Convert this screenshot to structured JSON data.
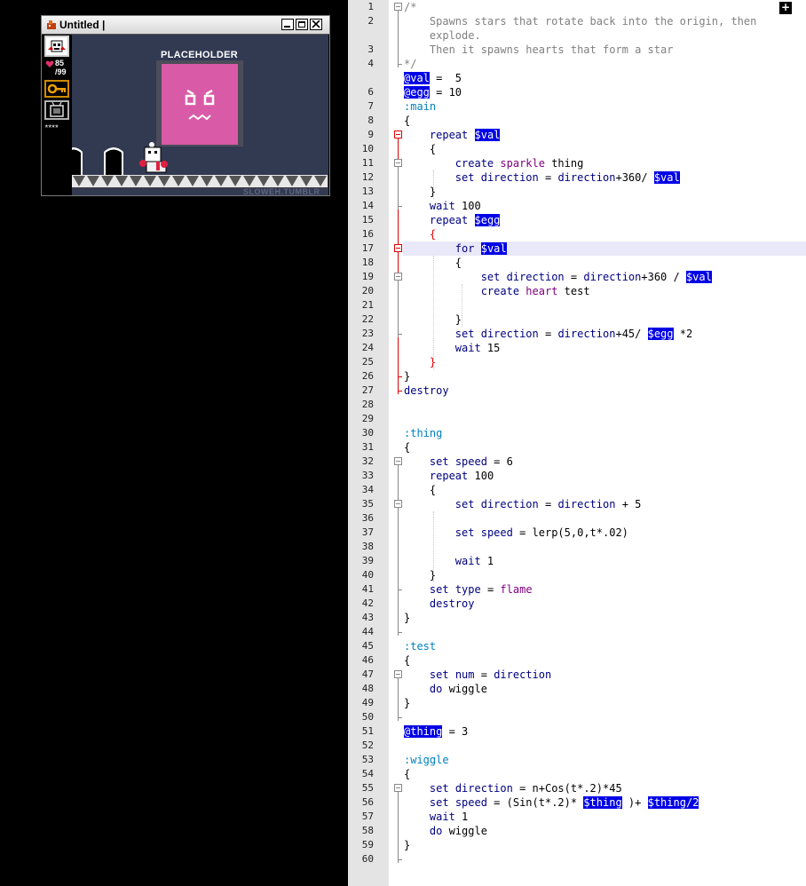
{
  "window": {
    "title": "Untitled |"
  },
  "hud": {
    "health": "85",
    "health_max": "/99",
    "stars": "★★★★"
  },
  "stage": {
    "placeholder_label": "PLACEHOLDER",
    "watermark": "SLOWEH.TUMBLR"
  },
  "editor": {
    "plus_button": "+",
    "lines": [
      [
        [
          "c",
          "/*"
        ]
      ],
      [
        [
          "c",
          "    Spawns stars that rotate back into the origin, then"
        ]
      ],
      [
        [
          "c",
          "    explode."
        ]
      ],
      [
        [
          "c",
          "    Then it spawns hearts that form a star"
        ]
      ],
      [
        [
          "c",
          "*/"
        ]
      ],
      [
        [
          "v",
          "@val"
        ],
        [
          "n",
          " =  5"
        ]
      ],
      [
        [
          "v",
          "@egg"
        ],
        [
          "n",
          " = 10"
        ]
      ],
      [
        [
          "lbl",
          ":main"
        ]
      ],
      [
        [
          "n",
          "{"
        ]
      ],
      [
        [
          "n",
          "    "
        ],
        [
          "k",
          "repeat"
        ],
        [
          "n",
          " "
        ],
        [
          "v",
          "$val"
        ]
      ],
      [
        [
          "n",
          "    {"
        ]
      ],
      [
        [
          "n",
          "        "
        ],
        [
          "k",
          "create"
        ],
        [
          "n",
          " "
        ],
        [
          "p",
          "sparkle"
        ],
        [
          "n",
          " thing"
        ]
      ],
      [
        [
          "n",
          "        "
        ],
        [
          "k",
          "set"
        ],
        [
          "n",
          " "
        ],
        [
          "k",
          "direction"
        ],
        [
          "n",
          " = "
        ],
        [
          "k",
          "direction"
        ],
        [
          "n",
          "+360/ "
        ],
        [
          "v",
          "$val"
        ]
      ],
      [
        [
          "n",
          "    }"
        ]
      ],
      [
        [
          "n",
          "    "
        ],
        [
          "k",
          "wait"
        ],
        [
          "n",
          " 100"
        ]
      ],
      [
        [
          "n",
          "    "
        ],
        [
          "k",
          "repeat"
        ],
        [
          "n",
          " "
        ],
        [
          "v",
          "$egg"
        ]
      ],
      [
        [
          "n",
          "    "
        ],
        [
          "redbrace",
          "{"
        ]
      ],
      [
        [
          "n",
          "        "
        ],
        [
          "k",
          "for"
        ],
        [
          "n",
          " "
        ],
        [
          "v",
          "$val"
        ]
      ],
      [
        [
          "n",
          "        {"
        ]
      ],
      [
        [
          "n",
          "            "
        ],
        [
          "k",
          "set"
        ],
        [
          "n",
          " "
        ],
        [
          "k",
          "direction"
        ],
        [
          "n",
          " = "
        ],
        [
          "k",
          "direction"
        ],
        [
          "n",
          "+360 / "
        ],
        [
          "v",
          "$val"
        ]
      ],
      [
        [
          "n",
          "            "
        ],
        [
          "k",
          "create"
        ],
        [
          "n",
          " "
        ],
        [
          "p",
          "heart"
        ],
        [
          "n",
          " test"
        ]
      ],
      [
        [
          "n",
          ""
        ]
      ],
      [
        [
          "n",
          "        }"
        ]
      ],
      [
        [
          "n",
          "        "
        ],
        [
          "k",
          "set"
        ],
        [
          "n",
          " "
        ],
        [
          "k",
          "direction"
        ],
        [
          "n",
          " = "
        ],
        [
          "k",
          "direction"
        ],
        [
          "n",
          "+45/ "
        ],
        [
          "v",
          "$egg"
        ],
        [
          "n",
          " *2"
        ]
      ],
      [
        [
          "n",
          "        "
        ],
        [
          "k",
          "wait"
        ],
        [
          "n",
          " 15"
        ]
      ],
      [
        [
          "n",
          "    "
        ],
        [
          "redbrace",
          "}"
        ]
      ],
      [
        [
          "n",
          "}"
        ]
      ],
      [
        [
          "k",
          "destroy"
        ]
      ],
      [
        [
          "n",
          ""
        ]
      ],
      [
        [
          "n",
          ""
        ]
      ],
      [
        [
          "lbl",
          ":thing"
        ]
      ],
      [
        [
          "n",
          "{"
        ]
      ],
      [
        [
          "n",
          "    "
        ],
        [
          "k",
          "set"
        ],
        [
          "n",
          " "
        ],
        [
          "k",
          "speed"
        ],
        [
          "n",
          " = 6"
        ]
      ],
      [
        [
          "n",
          "    "
        ],
        [
          "k",
          "repeat"
        ],
        [
          "n",
          " 100"
        ]
      ],
      [
        [
          "n",
          "    {"
        ]
      ],
      [
        [
          "n",
          "        "
        ],
        [
          "k",
          "set"
        ],
        [
          "n",
          " "
        ],
        [
          "k",
          "direction"
        ],
        [
          "n",
          " = "
        ],
        [
          "k",
          "direction"
        ],
        [
          "n",
          " + 5"
        ]
      ],
      [
        [
          "n",
          ""
        ]
      ],
      [
        [
          "n",
          "        "
        ],
        [
          "k",
          "set"
        ],
        [
          "n",
          " "
        ],
        [
          "k",
          "speed"
        ],
        [
          "n",
          " = lerp(5,0,t*.02)"
        ]
      ],
      [
        [
          "n",
          ""
        ]
      ],
      [
        [
          "n",
          "        "
        ],
        [
          "k",
          "wait"
        ],
        [
          "n",
          " 1"
        ]
      ],
      [
        [
          "n",
          "    }"
        ]
      ],
      [
        [
          "n",
          "    "
        ],
        [
          "k",
          "set"
        ],
        [
          "n",
          " "
        ],
        [
          "k",
          "type"
        ],
        [
          "n",
          " = "
        ],
        [
          "p",
          "flame"
        ]
      ],
      [
        [
          "n",
          "    "
        ],
        [
          "k",
          "destroy"
        ]
      ],
      [
        [
          "n",
          "}"
        ]
      ],
      [
        [
          "n",
          ""
        ]
      ],
      [
        [
          "lbl",
          ":test"
        ]
      ],
      [
        [
          "n",
          "{"
        ]
      ],
      [
        [
          "n",
          "    "
        ],
        [
          "k",
          "set"
        ],
        [
          "n",
          " "
        ],
        [
          "k",
          "num"
        ],
        [
          "n",
          " = "
        ],
        [
          "k",
          "direction"
        ]
      ],
      [
        [
          "n",
          "    "
        ],
        [
          "k",
          "do"
        ],
        [
          "n",
          " wiggle"
        ]
      ],
      [
        [
          "n",
          "}"
        ]
      ],
      [
        [
          "n",
          ""
        ]
      ],
      [
        [
          "v",
          "@thing"
        ],
        [
          "n",
          " = 3"
        ]
      ],
      [
        [
          "n",
          ""
        ]
      ],
      [
        [
          "lbl",
          ":wiggle"
        ]
      ],
      [
        [
          "n",
          "{"
        ]
      ],
      [
        [
          "n",
          "    "
        ],
        [
          "k",
          "set"
        ],
        [
          "n",
          " "
        ],
        [
          "k",
          "direction"
        ],
        [
          "n",
          " = n+Cos(t*.2)*45"
        ]
      ],
      [
        [
          "n",
          "    "
        ],
        [
          "k",
          "set"
        ],
        [
          "n",
          " "
        ],
        [
          "k",
          "speed"
        ],
        [
          "n",
          " = (Sin(t*.2)* "
        ],
        [
          "v",
          "$thing"
        ],
        [
          "n",
          " )+ "
        ],
        [
          "v",
          "$thing/2"
        ]
      ],
      [
        [
          "n",
          "    "
        ],
        [
          "k",
          "wait"
        ],
        [
          "n",
          " 1"
        ]
      ],
      [
        [
          "n",
          "    "
        ],
        [
          "k",
          "do"
        ],
        [
          "n",
          " wiggle"
        ]
      ],
      [
        [
          "n",
          "}"
        ]
      ]
    ],
    "line_numbers": [
      "1",
      "2",
      "",
      "3",
      "4",
      "",
      "6",
      "7",
      "8",
      "9",
      "10",
      "11",
      "12",
      "13",
      "14",
      "15",
      "16",
      "17",
      "18",
      "19",
      "20",
      "21",
      "22",
      "23",
      "24",
      "25",
      "26",
      "27",
      "28",
      "29",
      "30",
      "31",
      "32",
      "33",
      "34",
      "35",
      "36",
      "37",
      "38",
      "39",
      "40",
      "41",
      "42",
      "43",
      "44",
      "45",
      "46",
      "47",
      "48",
      "49",
      "50",
      "51",
      "52",
      "53",
      "54",
      "55",
      "56",
      "57",
      "58",
      "59",
      "60"
    ]
  }
}
